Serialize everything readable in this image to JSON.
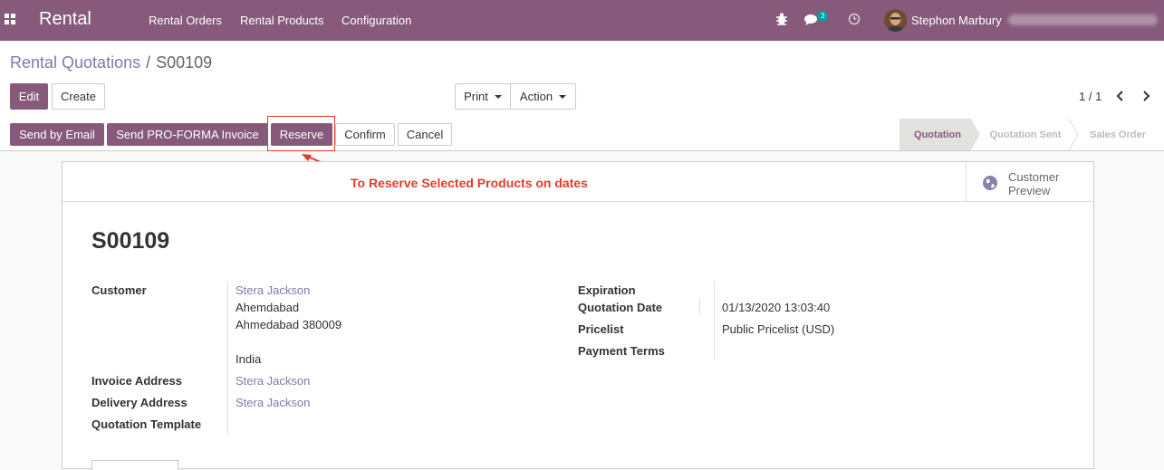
{
  "app": {
    "title": "Rental"
  },
  "menu": [
    "Rental Orders",
    "Rental Products",
    "Configuration"
  ],
  "systray": {
    "bug_icon": "bug-icon",
    "chat_icon": "chat-icon",
    "chat_count": "3",
    "activity_icon": "clock-icon",
    "user_name": "Stephon Marbury"
  },
  "breadcrumb": {
    "parent": "Rental Quotations",
    "separator": "/",
    "current": "S00109"
  },
  "buttons": {
    "edit": "Edit",
    "create": "Create",
    "print": "Print",
    "action": "Action"
  },
  "pager": {
    "value": "1 / 1"
  },
  "header_buttons": [
    "Send by Email",
    "Send PRO-FORMA Invoice",
    "Reserve",
    "Confirm",
    "Cancel"
  ],
  "stages": [
    "Quotation",
    "Quotation Sent",
    "Sales Order"
  ],
  "active_stage": "Quotation",
  "annotation": "To Reserve Selected Products on dates",
  "customer_preview": {
    "line1": "Customer",
    "line2": "Preview",
    "icon": "globe-icon"
  },
  "record": {
    "name": "S00109",
    "customer_label": "Customer",
    "customer_name": "Stera Jackson",
    "address": [
      "Ahemdabad",
      "Ahmedabad 380009",
      "India"
    ],
    "invoice_address_label": "Invoice Address",
    "invoice_address": "Stera Jackson",
    "delivery_address_label": "Delivery Address",
    "delivery_address": "Stera Jackson",
    "quotation_template_label": "Quotation Template",
    "expiration_label": "Expiration",
    "quotation_date_label": "Quotation Date",
    "quotation_date": "01/13/2020 13:03:40",
    "pricelist_label": "Pricelist",
    "pricelist": "Public Pricelist (USD)",
    "payment_terms_label": "Payment Terms"
  },
  "colors": {
    "brand": "#875a7b",
    "link": "#7c7bad",
    "annotation": "#e23b2c"
  }
}
